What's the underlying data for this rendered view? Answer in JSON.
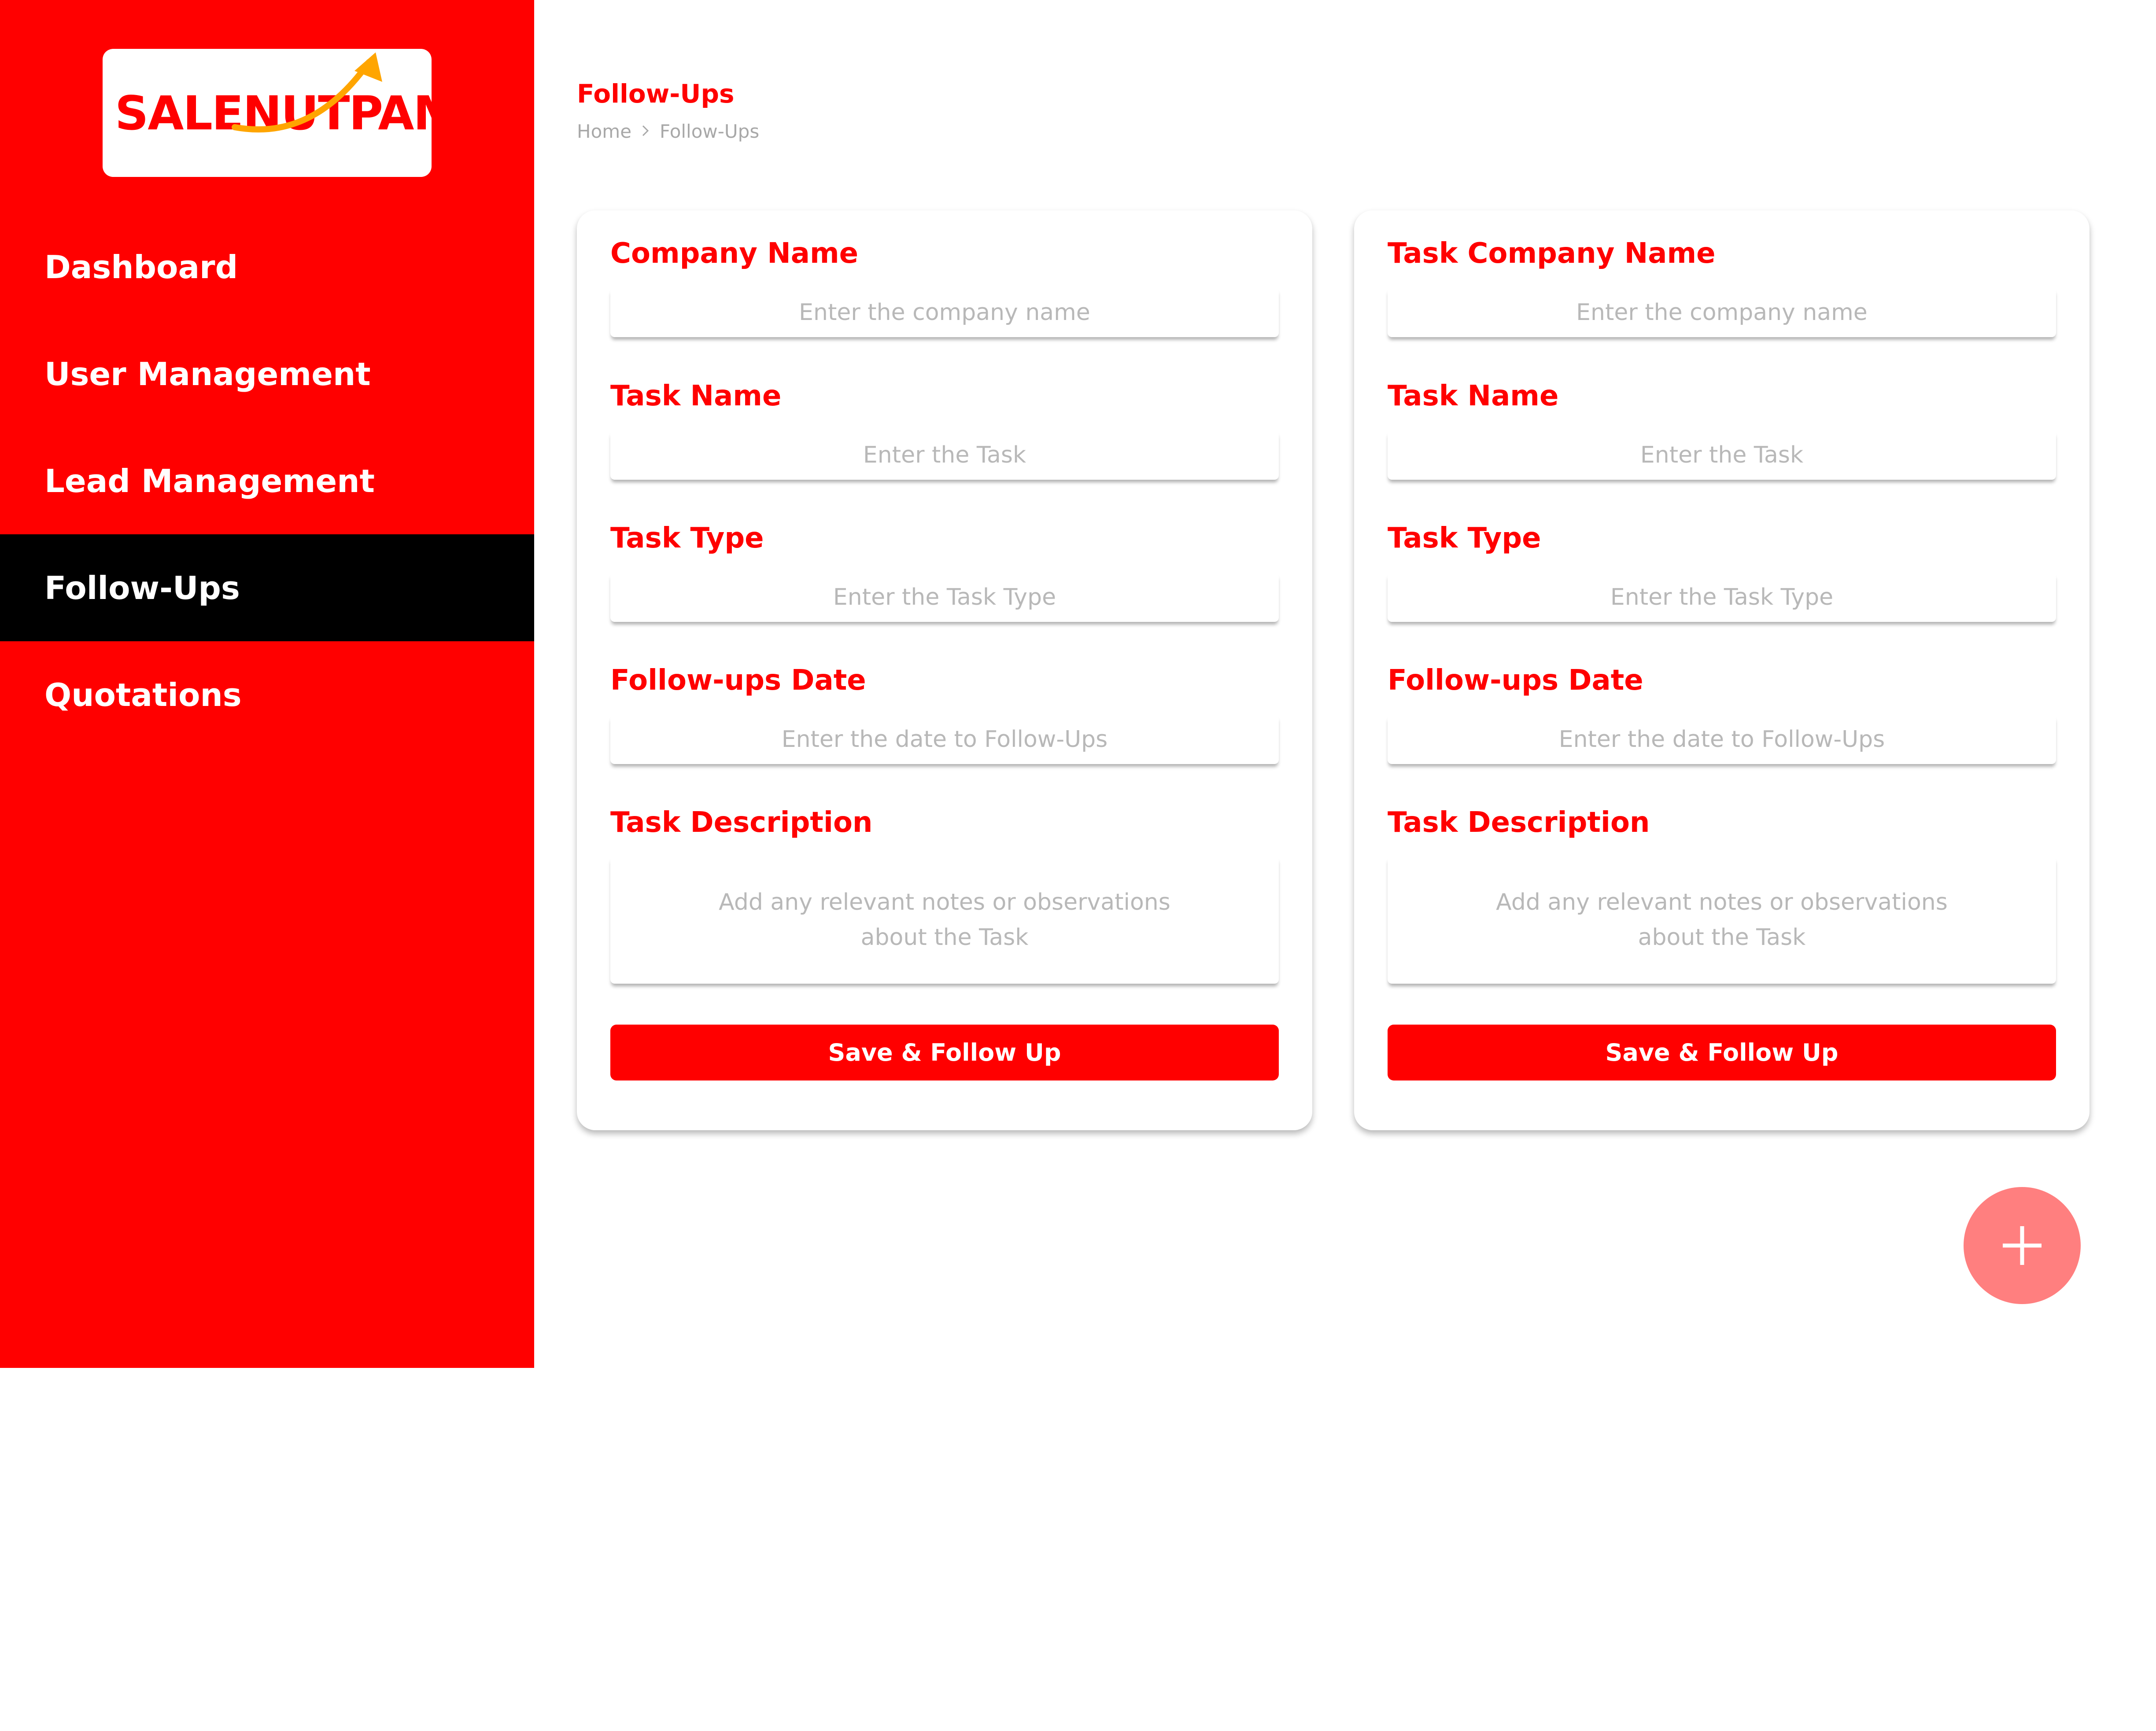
{
  "brand": {
    "name": "SALENUTPAM",
    "colors": {
      "primary": "#ff0000",
      "accent_arrow": "#ffa500",
      "fab": "#ff7f7f",
      "active_nav": "#000000"
    },
    "logo_icon": "trend-arrow-icon"
  },
  "sidebar": {
    "items": [
      {
        "label": "Dashboard",
        "active": false
      },
      {
        "label": "User Management",
        "active": false
      },
      {
        "label": "Lead Management",
        "active": false
      },
      {
        "label": "Follow-Ups",
        "active": true
      },
      {
        "label": "Quotations",
        "active": false
      }
    ]
  },
  "header": {
    "title": "Follow-Ups",
    "breadcrumb": {
      "home": "Home",
      "separator_icon": "chevron-right-icon",
      "current": "Follow-Ups"
    }
  },
  "cards": [
    {
      "company_label": "Company Name",
      "company_placeholder": "Enter the company name",
      "task_name_label": "Task Name",
      "task_name_placeholder": "Enter the Task",
      "task_type_label": "Task Type",
      "task_type_placeholder": "Enter the Task Type",
      "date_label": "Follow-ups Date",
      "date_placeholder": "Enter the date to Follow-Ups",
      "description_label": "Task Description",
      "description_placeholder": "Add any relevant notes or observations about the Task",
      "save_label": "Save & Follow Up"
    },
    {
      "company_label": "Task Company Name",
      "company_placeholder": "Enter the company name",
      "task_name_label": "Task Name",
      "task_name_placeholder": "Enter the Task",
      "task_type_label": "Task Type",
      "task_type_placeholder": "Enter the Task Type",
      "date_label": "Follow-ups Date",
      "date_placeholder": "Enter the date to Follow-Ups",
      "description_label": "Task Description",
      "description_placeholder": "Add any relevant notes or observations about the Task",
      "save_label": "Save & Follow Up"
    }
  ],
  "fab": {
    "icon": "plus-icon"
  }
}
